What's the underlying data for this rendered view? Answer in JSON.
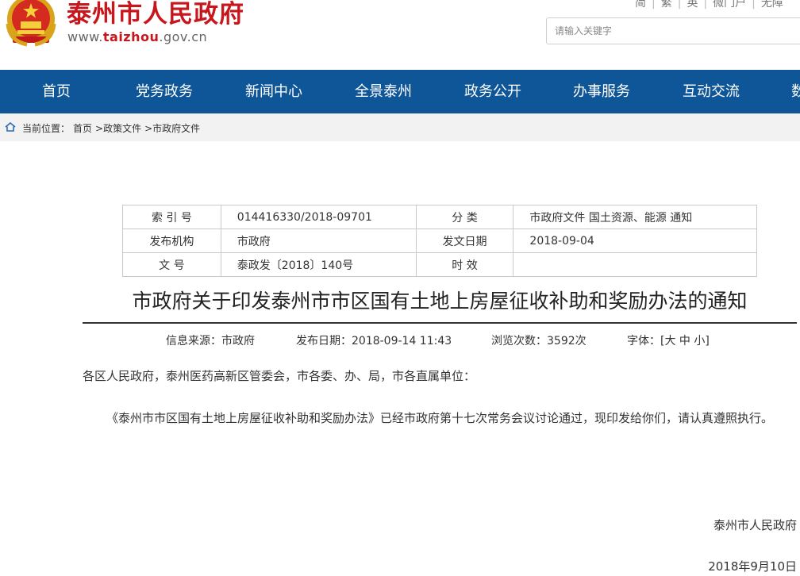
{
  "header": {
    "site_title": "泰州市人民政府",
    "url_prefix": "www.",
    "url_highlight": "taizhou",
    "url_suffix": ".gov.cn",
    "top_links": [
      "简",
      "繁",
      "英",
      "微门户",
      "无障"
    ],
    "search_placeholder": "请输入关键字"
  },
  "nav": {
    "items": [
      "首页",
      "党务政务",
      "新闻中心",
      "全景泰州",
      "政务公开",
      "办事服务",
      "互动交流",
      "数"
    ]
  },
  "breadcrumb": {
    "label": "当前位置：",
    "items": [
      "首页",
      ">政策文件",
      ">市政府文件"
    ]
  },
  "info_table": {
    "index_label": "索 引 号",
    "index_value": "014416330/2018-09701",
    "category_label": "分 类",
    "category_value": "市政府文件 国土资源、能源 通知",
    "publisher_label": "发布机构",
    "publisher_value": "市政府",
    "issue_date_label": "发文日期",
    "issue_date_value": "2018-09-04",
    "doc_no_label": "文 号",
    "doc_no_value": "泰政发〔2018〕140号",
    "validity_label": "时 效",
    "validity_value": ""
  },
  "article": {
    "title": "市政府关于印发泰州市市区国有土地上房屋征收补助和奖励办法的通知",
    "source": "信息来源：市政府",
    "publish_date": "发布日期：2018-09-14 11:43",
    "views": "浏览次数：3592次",
    "font_label": "字体：[",
    "font_large": "大",
    "font_medium": "中",
    "font_small": "小]",
    "addressee": "各区人民政府，泰州医药高新区管委会，市各委、办、局，市各直属单位：",
    "paragraph": "《泰州市市区国有土地上房屋征收补助和奖励办法》已经市政府第十七次常务会议讨论通过，现印发给你们，请认真遵照执行。",
    "signature": "泰州市人民政府",
    "sign_date": "2018年9月10日"
  },
  "colors": {
    "brand_red": "#c8161d",
    "nav_blue": "#0f5699",
    "breadcrumb_bg": "#f2f2f2"
  }
}
